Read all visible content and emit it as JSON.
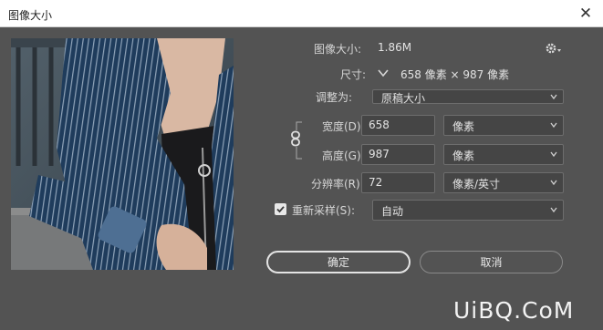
{
  "window": {
    "title": "图像大小",
    "close_glyph": "✕"
  },
  "image_size": {
    "label": "图像大小:",
    "value": "1.86M"
  },
  "dimensions": {
    "label": "尺寸:",
    "value": "658 像素 × 987 像素"
  },
  "fit_to": {
    "label": "调整为:",
    "value": "原稿大小"
  },
  "width": {
    "label": "宽度(D):",
    "value": "658",
    "unit": "像素"
  },
  "height": {
    "label": "高度(G):",
    "value": "987",
    "unit": "像素"
  },
  "resolution": {
    "label": "分辨率(R):",
    "value": "72",
    "unit": "像素/英寸"
  },
  "resample": {
    "label": "重新采样(S):",
    "value": "自动",
    "checked": true
  },
  "buttons": {
    "ok": "确定",
    "cancel": "取消"
  },
  "watermark": "UiBQ.CoM",
  "colors": {
    "dialog_bg": "#535353",
    "field_bg": "#454545",
    "titlebar_bg": "#ffffff"
  },
  "icons": {
    "settings": "gear-icon",
    "link": "chain-link-icon",
    "dropdown": "chevron-down-icon",
    "checkbox": "checkmark-icon"
  }
}
